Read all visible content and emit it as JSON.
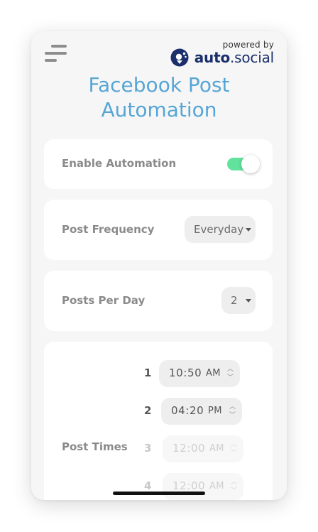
{
  "header": {
    "powered_by": "powered by",
    "brand_part1": "auto",
    "brand_dot": ".",
    "brand_part2": "social"
  },
  "page": {
    "title_line1": "Facebook Post",
    "title_line2": "Automation"
  },
  "automation": {
    "label": "Enable Automation",
    "enabled": true
  },
  "frequency": {
    "label": "Post Frequency",
    "selected": "Everyday"
  },
  "posts_per_day": {
    "label": "Posts Per Day",
    "selected": "2"
  },
  "post_times": {
    "label": "Post Times",
    "items": [
      {
        "index": "1",
        "time": "10:50",
        "period": "AM",
        "enabled": true
      },
      {
        "index": "2",
        "time": "04:20",
        "period": "PM",
        "enabled": true
      },
      {
        "index": "3",
        "time": "12:00",
        "period": "AM",
        "enabled": false
      },
      {
        "index": "4",
        "time": "12:00",
        "period": "AM",
        "enabled": false
      }
    ]
  },
  "colors": {
    "title": "#56a5d6",
    "toggle_on": "#61e29d",
    "brand": "#1a2f6b"
  },
  "icons": {
    "menu": "hamburger-menu-icon",
    "logo": "autosocial-logo-icon",
    "dropdown": "caret-down-icon",
    "stepper": "chevron-up-down-icon"
  }
}
